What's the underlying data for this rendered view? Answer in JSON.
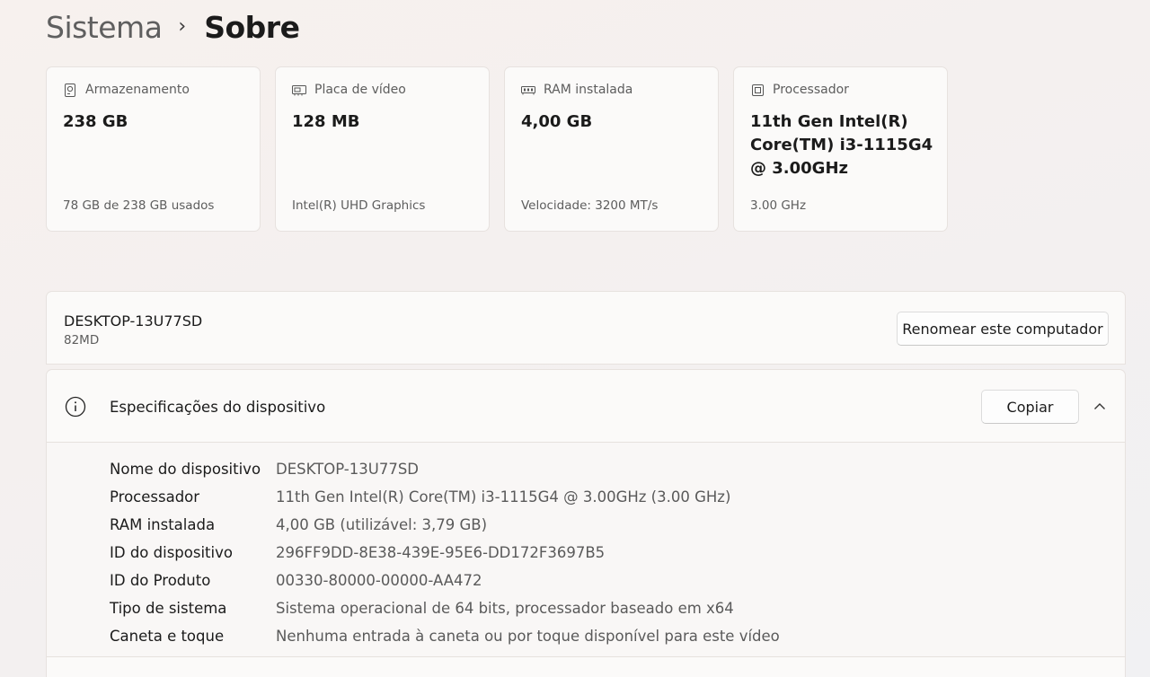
{
  "breadcrumb": {
    "parent": "Sistema",
    "separator": "›",
    "current": "Sobre"
  },
  "cards": [
    {
      "icon": "storage-icon",
      "label": "Armazenamento",
      "value": "238 GB",
      "sub": "78 GB de 238 GB usados"
    },
    {
      "icon": "gpu-icon",
      "label": "Placa de vídeo",
      "value": "128 MB",
      "sub": "Intel(R) UHD Graphics"
    },
    {
      "icon": "ram-icon",
      "label": "RAM instalada",
      "value": "4,00 GB",
      "sub": "Velocidade: 3200 MT/s"
    },
    {
      "icon": "processor-icon",
      "label": "Processador",
      "value": "11th Gen Intel(R) Core(TM) i3-1115G4 @ 3.00GHz",
      "sub": "3.00 GHz"
    }
  ],
  "device": {
    "name": "DESKTOP-13U77SD",
    "model": "82MD",
    "rename_label": "Renomear este computador"
  },
  "specs": {
    "title": "Especificações do dispositivo",
    "copy_label": "Copiar",
    "rows": [
      {
        "label": "Nome do dispositivo",
        "value": "DESKTOP-13U77SD"
      },
      {
        "label": "Processador",
        "value": "11th Gen Intel(R) Core(TM) i3-1115G4 @ 3.00GHz (3.00 GHz)"
      },
      {
        "label": "RAM instalada",
        "value": "4,00 GB (utilizável: 3,79 GB)"
      },
      {
        "label": "ID do dispositivo",
        "value": "296FF9DD-8E38-439E-95E6-DD172F3697B5"
      },
      {
        "label": "ID do Produto",
        "value": "00330-80000-00000-AA472"
      },
      {
        "label": "Tipo de sistema",
        "value": "Sistema operacional de 64 bits, processador baseado em x64"
      },
      {
        "label": "Caneta e toque",
        "value": "Nenhuma entrada à caneta ou por toque disponível para este vídeo"
      }
    ]
  }
}
